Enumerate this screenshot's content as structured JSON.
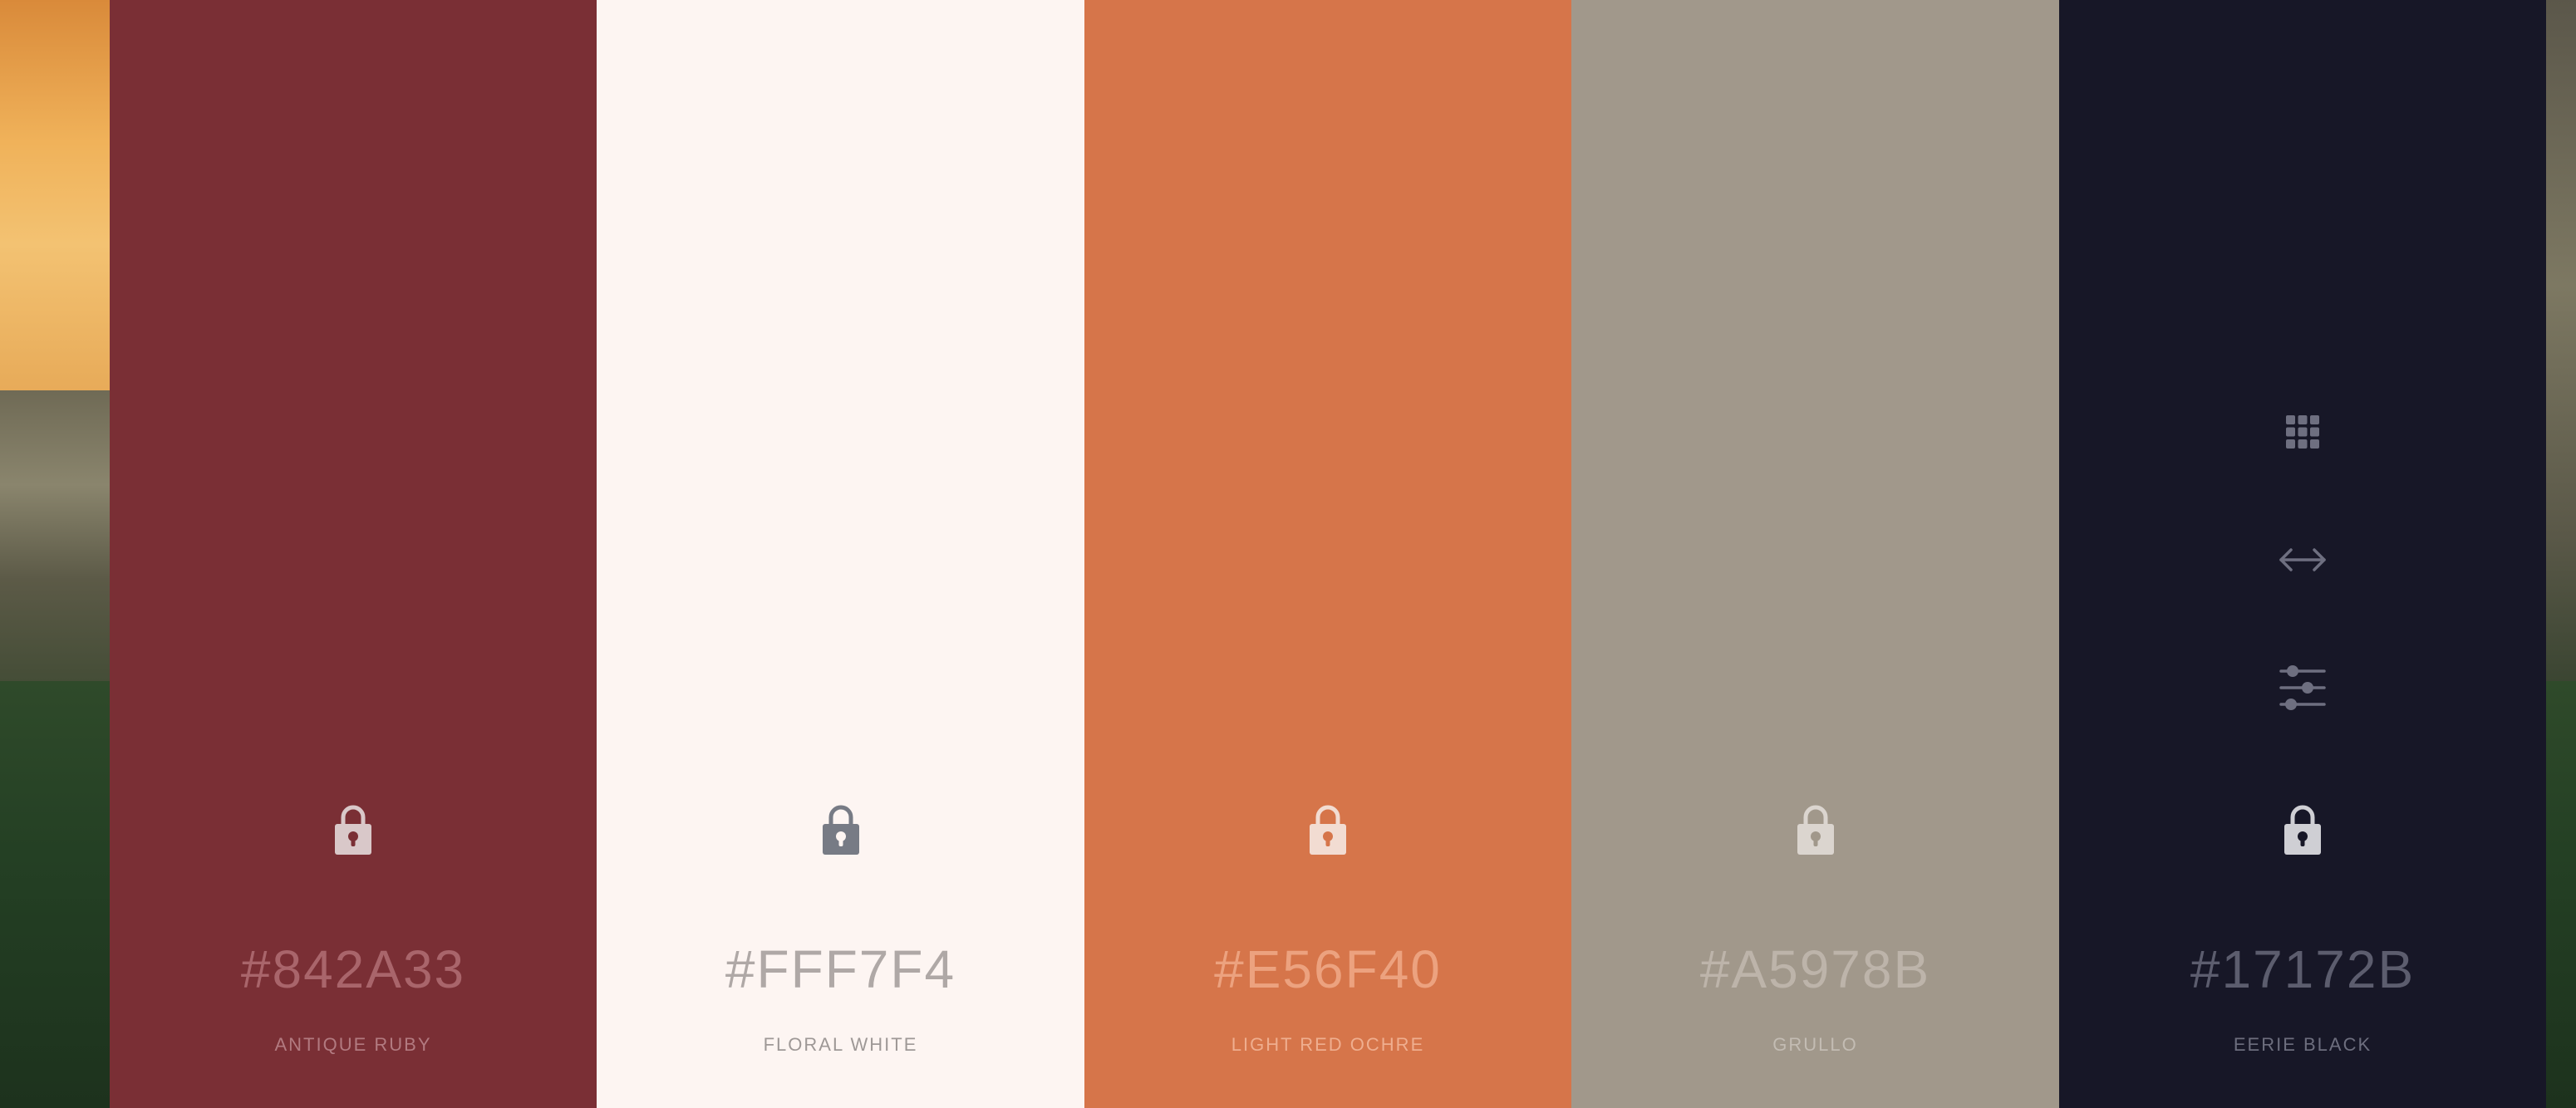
{
  "palette": [
    {
      "hex": "#842A33",
      "name": "ANTIQUE RUBY",
      "bg": "#7A2F35",
      "hex_color": "#A9656B",
      "name_color": "#B27A80",
      "lock_color": "#D9C8C9",
      "lock_hole": "#7A2F35"
    },
    {
      "hex": "#FFF7F4",
      "name": "FLORAL WHITE",
      "bg": "#FDF5F2",
      "hex_color": "#AFA8A6",
      "name_color": "#9E9896",
      "lock_color": "#777B85",
      "lock_hole": "#FDF5F2"
    },
    {
      "hex": "#E56F40",
      "name": "LIGHT RED OCHRE",
      "bg": "#D6754A",
      "hex_color": "#ECA27F",
      "name_color": "#EFAE8F",
      "lock_color": "#F2DCD2",
      "lock_hole": "#D6754A"
    },
    {
      "hex": "#A5978B",
      "name": "GRULLO",
      "bg": "#A1988B",
      "hex_color": "#BDB4AA",
      "name_color": "#C3BCB3",
      "lock_color": "#DBD5CF",
      "lock_hole": "#A1988B"
    },
    {
      "hex": "#17172B",
      "name": "EERIE BLACK",
      "bg": "#171727",
      "hex_color": "#5C5D6E",
      "name_color": "#6D6E7E",
      "lock_color": "#CFCFD4",
      "lock_hole": "#171727"
    }
  ],
  "tools": {
    "items": [
      {
        "icon": "grid-icon",
        "label": "View shades"
      },
      {
        "icon": "drag-arrows-icon",
        "label": "Drag"
      },
      {
        "icon": "sliders-icon",
        "label": "Adjust"
      }
    ],
    "color": "#6E6F80"
  }
}
